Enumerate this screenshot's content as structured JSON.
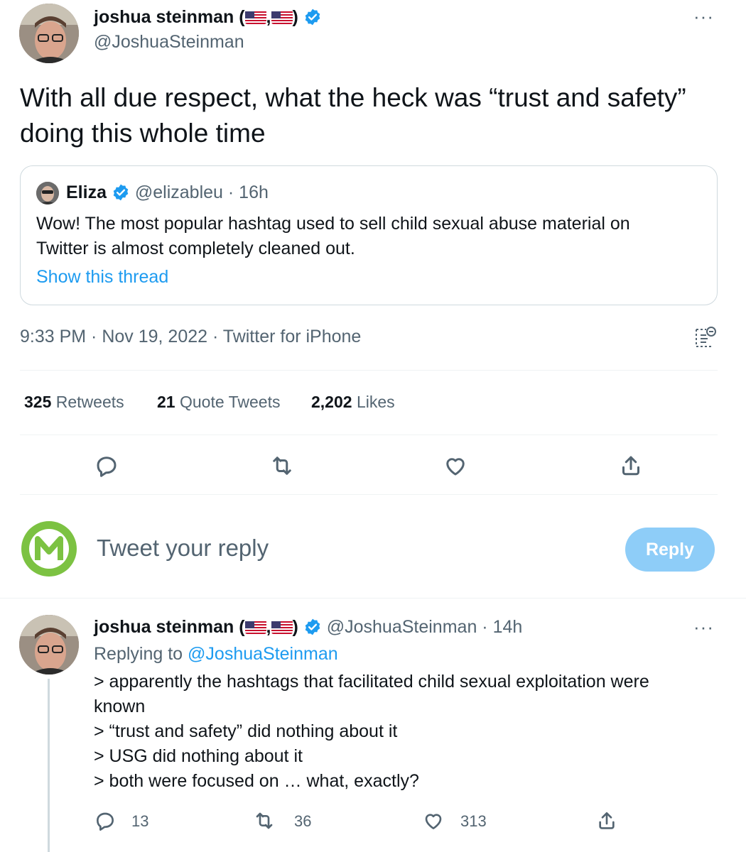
{
  "main_tweet": {
    "author_name": "joshua steinman (",
    "author_name_sep": ",",
    "author_name_close": ")",
    "author_handle": "@JoshuaSteinman",
    "more_label": "···",
    "text": "With all due respect, what the heck was “trust and safety” doing this whole time",
    "quoted": {
      "author_name": "Eliza",
      "author_handle": "@elizableu",
      "time": "· 16h",
      "text": "Wow! The most popular hashtag used to sell child sexual abuse material on Twitter is almost completely cleaned out.",
      "show_thread": "Show this thread"
    },
    "timestamp": "9:33 PM · Nov 19, 2022 · Twitter for iPhone",
    "stats": {
      "retweets_num": "325",
      "retweets_lbl": "Retweets",
      "quotes_num": "21",
      "quotes_lbl": "Quote Tweets",
      "likes_num": "2,202",
      "likes_lbl": "Likes"
    },
    "actions": [
      "reply-icon",
      "retweet-icon",
      "like-icon",
      "share-icon"
    ]
  },
  "composer": {
    "placeholder": "Tweet your reply",
    "reply_label": "Reply"
  },
  "reply_tweet": {
    "author_name": "joshua steinman (",
    "author_name_sep": ",",
    "author_name_close": ")",
    "author_handle": "@JoshuaSteinman",
    "time": "· 14h",
    "more_label": "···",
    "replying_prefix": "Replying to",
    "replying_handle": "@JoshuaSteinman",
    "lines": [
      "> apparently the hashtags that facilitated child sexual exploitation were known",
      "> “trust and safety” did nothing about it",
      "> USG did nothing about it",
      "> both were focused on … what, exactly?"
    ],
    "counts": {
      "replies": "13",
      "retweets": "36",
      "likes": "313"
    }
  },
  "colors": {
    "accent": "#1d9bf0",
    "reply_button": "#8ecdf8",
    "muted": "#536471",
    "logo_green": "#7cc242"
  }
}
